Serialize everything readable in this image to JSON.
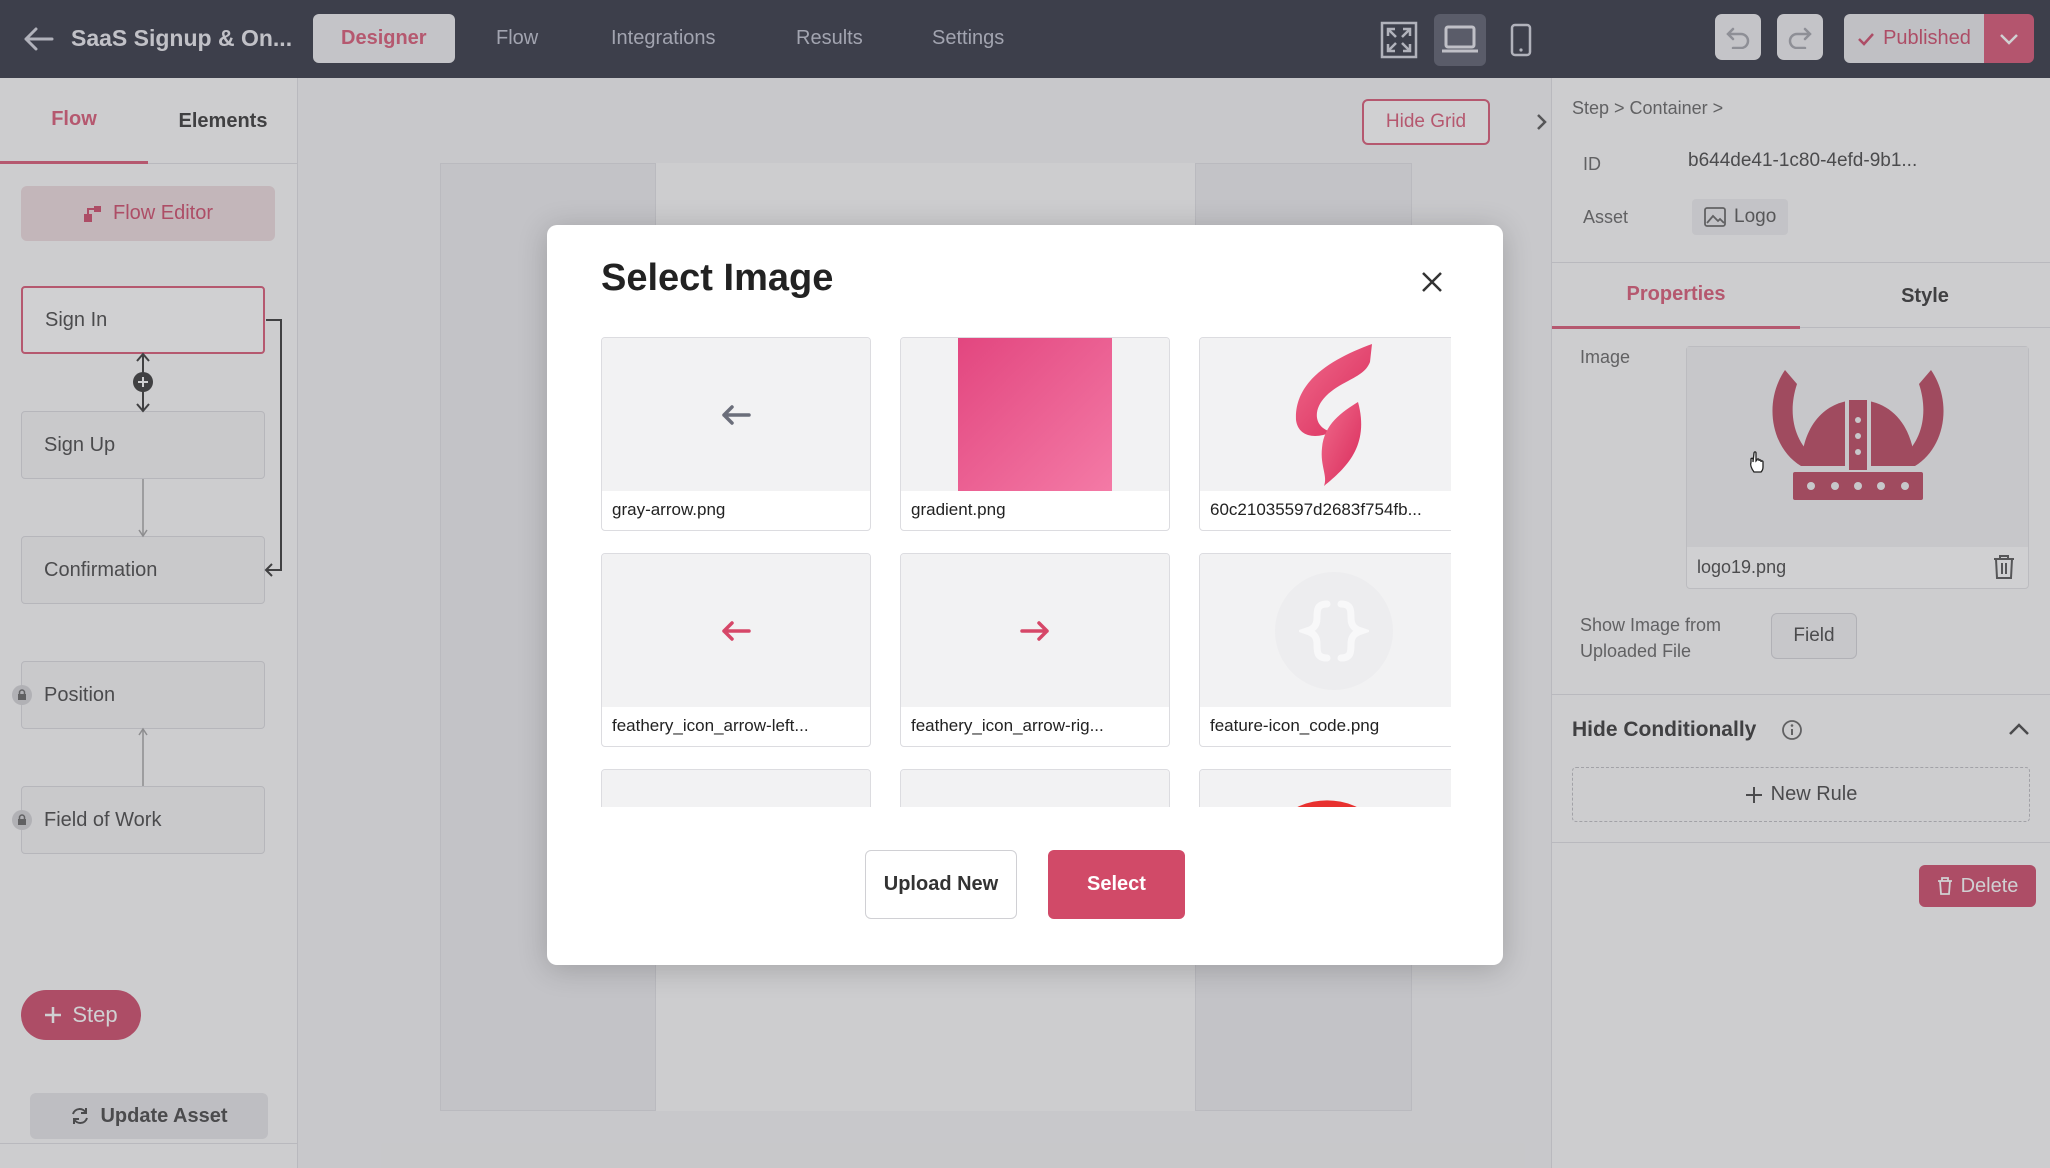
{
  "header": {
    "title": "SaaS Signup & On...",
    "tabs": [
      "Designer",
      "Flow",
      "Integrations",
      "Results",
      "Settings"
    ],
    "active_tab": "Designer",
    "publish_label": "Published"
  },
  "left_panel": {
    "tabs": [
      "Flow",
      "Elements"
    ],
    "active_tab": "Flow",
    "flow_editor_label": "Flow Editor",
    "steps": [
      {
        "label": "Sign In",
        "selected": true,
        "locked": false
      },
      {
        "label": "Sign Up",
        "selected": false,
        "locked": false
      },
      {
        "label": "Confirmation",
        "selected": false,
        "locked": false
      },
      {
        "label": "Position",
        "selected": false,
        "locked": true
      },
      {
        "label": "Field of Work",
        "selected": false,
        "locked": true
      }
    ],
    "add_step_label": "Step",
    "update_asset_label": "Update Asset"
  },
  "canvas": {
    "hide_grid_label": "Hide Grid"
  },
  "right_panel": {
    "breadcrumb": "Step > Container >",
    "id_label": "ID",
    "id_value": "b644de41-1c80-4efd-9b1...",
    "asset_label": "Asset",
    "asset_value": "Logo",
    "tabs": [
      "Properties",
      "Style"
    ],
    "active_tab": "Properties",
    "image_label": "Image",
    "image_file": "logo19.png",
    "show_image_label_1": "Show Image from",
    "show_image_label_2": "Uploaded File",
    "field_button": "Field",
    "hide_conditionally": "Hide Conditionally",
    "new_rule": "New Rule",
    "delete": "Delete"
  },
  "modal": {
    "title": "Select Image",
    "images": [
      {
        "name": "gray-arrow.png"
      },
      {
        "name": "gradient.png"
      },
      {
        "name": "60c21035597d2683f754fb..."
      },
      {
        "name": "feathery_icon_arrow-left..."
      },
      {
        "name": "feathery_icon_arrow-rig..."
      },
      {
        "name": "feature-icon_code.png"
      }
    ],
    "upload_new": "Upload New",
    "select": "Select"
  },
  "colors": {
    "accent": "#d64768",
    "topbar": "#1e2130",
    "gradient_from": "#e2467f",
    "gradient_to": "#f47aa6",
    "logo": "#b5344f"
  }
}
